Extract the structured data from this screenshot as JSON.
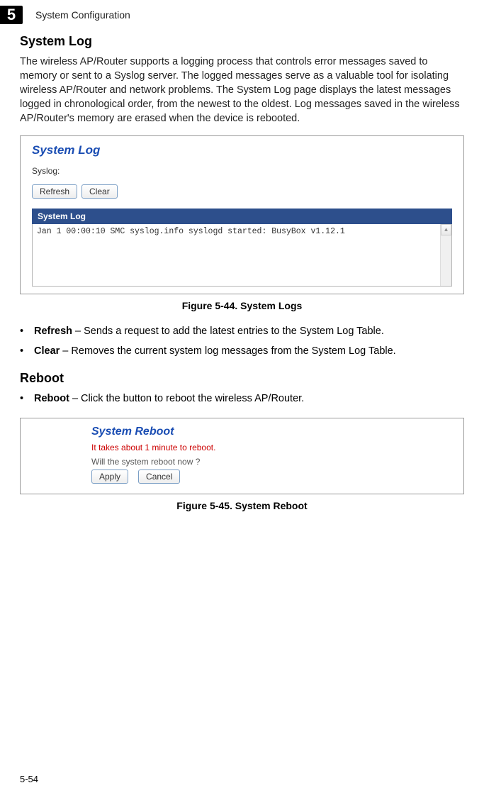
{
  "header": {
    "chapter_number": "5",
    "chapter_title": "System Configuration"
  },
  "section1": {
    "heading": "System Log",
    "body": "The wireless AP/Router supports a logging process that controls error messages saved to memory or sent to a Syslog server. The logged messages serve as a valuable tool for isolating wireless AP/Router and network problems. The System Log page displays the latest messages logged in chronological order, from the newest to the oldest. Log messages saved in the wireless AP/Router's memory are erased when the device is rebooted."
  },
  "figure1": {
    "panel_title": "System Log",
    "field_label": "Syslog:",
    "refresh_btn": "Refresh",
    "clear_btn": "Clear",
    "table_header": "System Log",
    "log_line": "Jan  1 00:00:10 SMC syslog.info syslogd started: BusyBox v1.12.1",
    "caption": "Figure 5-44.   System Logs"
  },
  "bullets1": [
    {
      "term": "Refresh",
      "desc": " – Sends a request to add the latest entries to the System Log Table."
    },
    {
      "term": "Clear",
      "desc": " – Removes the current system log messages from the System Log Table."
    }
  ],
  "section2": {
    "heading": "Reboot"
  },
  "bullets2": [
    {
      "term": "Reboot",
      "desc": " – Click the button to reboot the wireless AP/Router."
    }
  ],
  "figure2": {
    "panel_title": "System Reboot",
    "warn": "It takes about 1 minute to reboot.",
    "question": "Will the system reboot now ?",
    "apply_btn": "Apply",
    "cancel_btn": "Cancel",
    "caption": "Figure 5-45.   System Reboot"
  },
  "page_number": "5-54"
}
